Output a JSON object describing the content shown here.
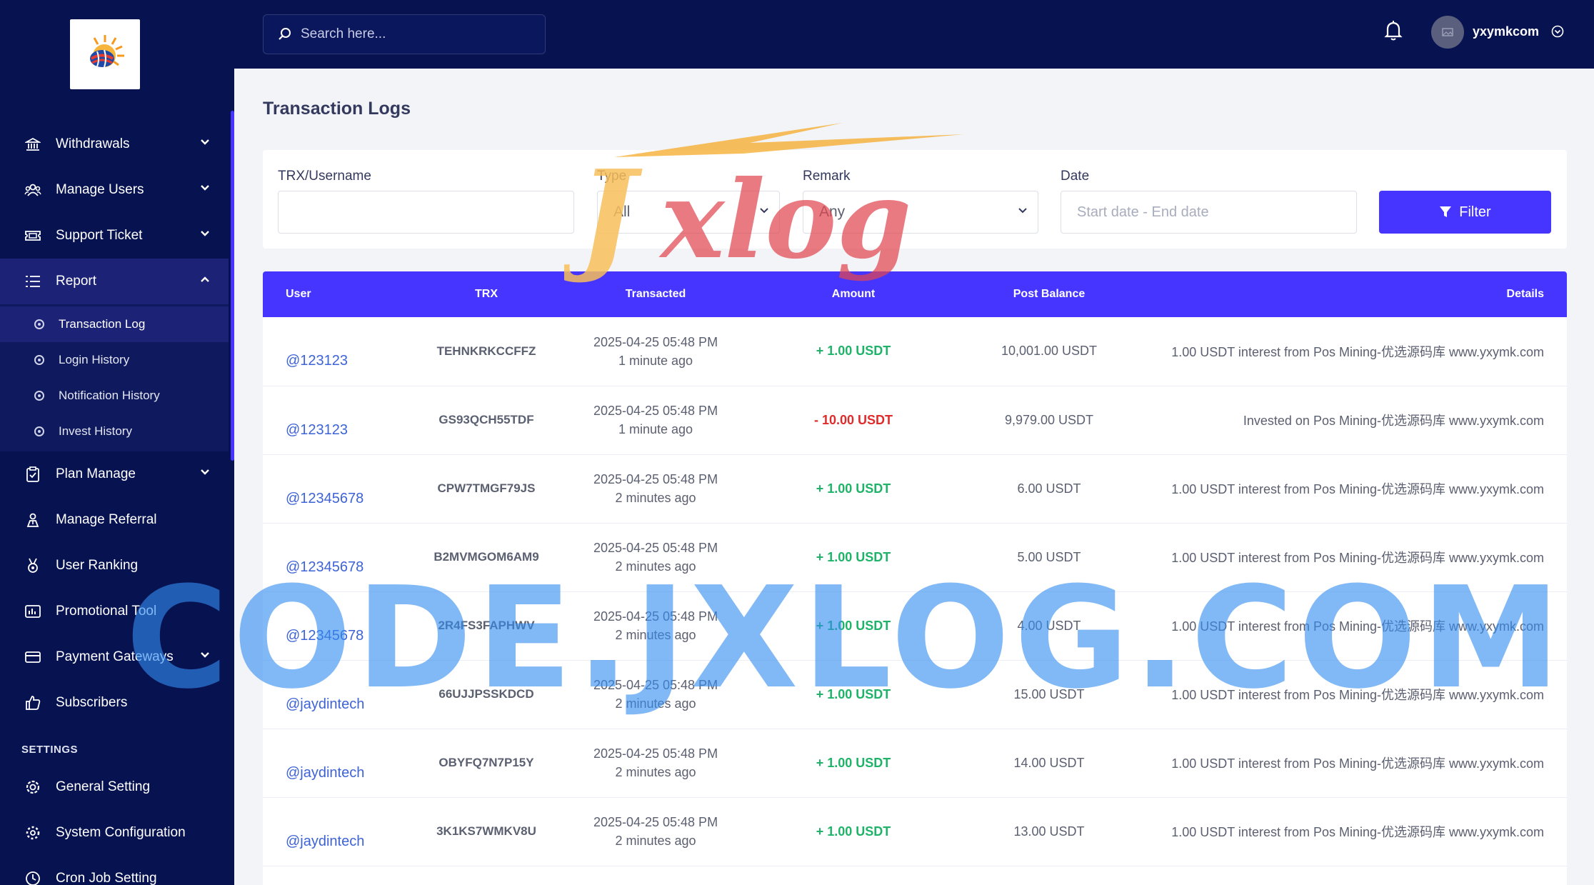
{
  "sidebar": {
    "items": [
      {
        "label": "Withdrawals",
        "icon": "bank-icon",
        "has_chevron": true
      },
      {
        "label": "Manage Users",
        "icon": "users-icon",
        "has_chevron": true
      },
      {
        "label": "Support Ticket",
        "icon": "ticket-icon",
        "has_chevron": true
      },
      {
        "label": "Report",
        "icon": "list-icon",
        "has_chevron": true,
        "expanded": true
      }
    ],
    "report_sub": [
      {
        "label": "Transaction Log",
        "active": true
      },
      {
        "label": "Login History"
      },
      {
        "label": "Notification History"
      },
      {
        "label": "Invest History"
      }
    ],
    "items2": [
      {
        "label": "Plan Manage",
        "icon": "clipboard-icon",
        "has_chevron": true
      },
      {
        "label": "Manage Referral",
        "icon": "referral-icon"
      },
      {
        "label": "User Ranking",
        "icon": "medal-icon"
      },
      {
        "label": "Promotional Tool",
        "icon": "chart-box-icon"
      },
      {
        "label": "Payment Gateways",
        "icon": "credit-card-icon",
        "has_chevron": true
      },
      {
        "label": "Subscribers",
        "icon": "thumbs-up-icon"
      }
    ],
    "settings_title": "SETTINGS",
    "settings_items": [
      {
        "label": "General Setting",
        "icon": "cog-icon"
      },
      {
        "label": "System Configuration",
        "icon": "cogs-icon"
      },
      {
        "label": "Cron Job Setting",
        "icon": "clock-icon"
      }
    ]
  },
  "topbar": {
    "search_placeholder": "Search here...",
    "username": "yxymkcom"
  },
  "page": {
    "title": "Transaction Logs"
  },
  "filters": {
    "trx_label": "TRX/Username",
    "trx_value": "",
    "type_label": "Type",
    "type_value": "All",
    "remark_label": "Remark",
    "remark_value": "Any",
    "date_label": "Date",
    "date_placeholder": "Start date - End date",
    "filter_button": "Filter"
  },
  "table": {
    "headers": [
      "User",
      "TRX",
      "Transacted",
      "Amount",
      "Post Balance",
      "Details"
    ],
    "rows": [
      {
        "user": "@123123",
        "trx": "TEHNKRKCCFFZ",
        "date": "2025-04-25 05:48 PM",
        "ago": "1 minute ago",
        "amount": "+ 1.00 USDT",
        "sign": "plus",
        "balance": "10,001.00 USDT",
        "details": "1.00 USDT interest from Pos Mining-优选源码库 www.yxymk.com"
      },
      {
        "user": "@123123",
        "trx": "GS93QCH55TDF",
        "date": "2025-04-25 05:48 PM",
        "ago": "1 minute ago",
        "amount": "- 10.00 USDT",
        "sign": "minus",
        "balance": "9,979.00 USDT",
        "details": "Invested on Pos Mining-优选源码库 www.yxymk.com"
      },
      {
        "user": "@12345678",
        "trx": "CPW7TMGF79JS",
        "date": "2025-04-25 05:48 PM",
        "ago": "2 minutes ago",
        "amount": "+ 1.00 USDT",
        "sign": "plus",
        "balance": "6.00 USDT",
        "details": "1.00 USDT interest from Pos Mining-优选源码库 www.yxymk.com"
      },
      {
        "user": "@12345678",
        "trx": "B2MVMGOM6AM9",
        "date": "2025-04-25 05:48 PM",
        "ago": "2 minutes ago",
        "amount": "+ 1.00 USDT",
        "sign": "plus",
        "balance": "5.00 USDT",
        "details": "1.00 USDT interest from Pos Mining-优选源码库 www.yxymk.com"
      },
      {
        "user": "@12345678",
        "trx": "2R4FS3FAPHWV",
        "date": "2025-04-25 05:48 PM",
        "ago": "2 minutes ago",
        "amount": "+ 1.00 USDT",
        "sign": "plus",
        "balance": "4.00 USDT",
        "details": "1.00 USDT interest from Pos Mining-优选源码库 www.yxymk.com"
      },
      {
        "user": "@jaydintech",
        "trx": "66UJJPSSKDCD",
        "date": "2025-04-25 05:48 PM",
        "ago": "2 minutes ago",
        "amount": "+ 1.00 USDT",
        "sign": "plus",
        "balance": "15.00 USDT",
        "details": "1.00 USDT interest from Pos Mining-优选源码库 www.yxymk.com"
      },
      {
        "user": "@jaydintech",
        "trx": "OBYFQ7N7P15Y",
        "date": "2025-04-25 05:48 PM",
        "ago": "2 minutes ago",
        "amount": "+ 1.00 USDT",
        "sign": "plus",
        "balance": "14.00 USDT",
        "details": "1.00 USDT interest from Pos Mining-优选源码库 www.yxymk.com"
      },
      {
        "user": "@jaydintech",
        "trx": "3K1KS7WMKV8U",
        "date": "2025-04-25 05:48 PM",
        "ago": "2 minutes ago",
        "amount": "+ 1.00 USDT",
        "sign": "plus",
        "balance": "13.00 USDT",
        "details": "1.00 USDT interest from Pos Mining-优选源码库 www.yxymk.com"
      }
    ]
  },
  "watermarks": {
    "top": "Jxlog",
    "big": "CODE.JXLOG.COM"
  },
  "colors": {
    "sidebar_bg": "#071251",
    "accent": "#4634ff",
    "positive": "#1fb36a",
    "negative": "#e02b2b",
    "link": "#3d63d6"
  }
}
